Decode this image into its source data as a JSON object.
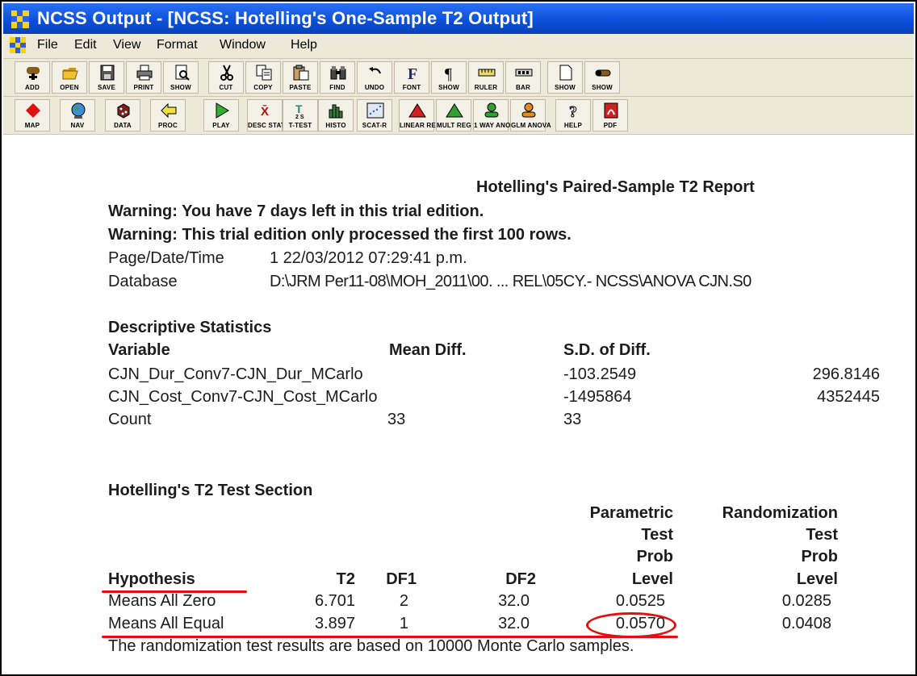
{
  "window": {
    "title": "NCSS Output - [NCSS: Hotelling's One-Sample T2 Output]"
  },
  "menu": [
    "File",
    "Edit",
    "View",
    "Format",
    "Window",
    "Help"
  ],
  "toolbar1": [
    {
      "label": "ADD",
      "icon": "add-icon"
    },
    {
      "label": "OPEN",
      "icon": "open-folder-icon"
    },
    {
      "label": "SAVE",
      "icon": "save-disk-icon"
    },
    {
      "label": "PRINT",
      "icon": "printer-icon"
    },
    {
      "label": "SHOW",
      "icon": "show-preview-icon"
    },
    {
      "label": "CUT",
      "icon": "scissors-icon"
    },
    {
      "label": "COPY",
      "icon": "copy-icon"
    },
    {
      "label": "PASTE",
      "icon": "paste-icon"
    },
    {
      "label": "FIND",
      "icon": "binoculars-icon"
    },
    {
      "label": "UNDO",
      "icon": "undo-icon"
    },
    {
      "label": "FONT",
      "icon": "font-icon"
    },
    {
      "label": "SHOW",
      "icon": "pilcrow-icon"
    },
    {
      "label": "RULER",
      "icon": "ruler-icon"
    },
    {
      "label": "BAR",
      "icon": "bar-icon"
    },
    {
      "label": "SHOW",
      "icon": "page-icon"
    },
    {
      "label": "SHOW",
      "icon": "pill-icon"
    }
  ],
  "toolbar2": [
    {
      "label": "MAP",
      "icon": "map-diamond-icon"
    },
    {
      "label": "NAV",
      "icon": "globe-icon"
    },
    {
      "label": "DATA",
      "icon": "data-icon"
    },
    {
      "label": "PROC",
      "icon": "back-arrow-icon"
    },
    {
      "label": "PLAY",
      "icon": "play-icon"
    },
    {
      "label": "DESC STATS",
      "glyph": "X̄",
      "icon": "desc-stats-icon"
    },
    {
      "label": "T-TEST",
      "glyph": "2 S",
      "icon": "t-test-icon"
    },
    {
      "label": "HISTO",
      "icon": "histogram-icon"
    },
    {
      "label": "SCAT-R",
      "icon": "scatter-icon"
    },
    {
      "label": "LINEAR REG",
      "icon": "linear-reg-icon"
    },
    {
      "label": "MULT REG",
      "icon": "mult-reg-icon"
    },
    {
      "label": "1 WAY ANOVA",
      "icon": "one-way-anova-icon"
    },
    {
      "label": "GLM ANOVA",
      "icon": "glm-anova-icon"
    },
    {
      "label": "HELP",
      "icon": "help-icon"
    },
    {
      "label": "PDF",
      "icon": "pdf-icon"
    }
  ],
  "report": {
    "heading": "Hotelling's Paired-Sample T2 Report",
    "warning1": "Warning: You have 7 days left in this trial edition.",
    "warning2": "Warning: This trial edition only processed the first 100 rows.",
    "page_label": "Page/Date/Time",
    "page_value": "1   22/03/2012 07:29:41 p.m.",
    "db_label": "Database",
    "db_value": "D:\\JRM Per11-08\\MOH_2011\\00. ... REL\\05CY.- NCSS\\ANOVA CJN.S0"
  },
  "descriptive": {
    "title": "Descriptive Statistics",
    "headers": {
      "variable": "Variable",
      "mean": "Mean Diff.",
      "sd": "S.D. of Diff."
    },
    "rows": [
      {
        "name": "CJN_Dur_Conv7-CJN_Dur_MCarlo",
        "mean": "",
        "sd": "-103.2549",
        "extra": "296.8146"
      },
      {
        "name": "CJN_Cost_Conv7-CJN_Cost_MCarlo",
        "mean": "",
        "sd": "-1495864",
        "extra": "4352445"
      },
      {
        "name": "Count",
        "mean": "33",
        "sd": "33",
        "extra": ""
      }
    ]
  },
  "t2test": {
    "title": "Hotelling's T2 Test Section",
    "param_header": [
      "Parametric",
      "Test",
      "Prob",
      "Level"
    ],
    "rand_header": [
      "Randomization",
      "Test",
      "Prob",
      "Level"
    ],
    "headers": {
      "hypothesis": "Hypothesis",
      "t2": "T2",
      "df1": "DF1",
      "df2": "DF2"
    },
    "rows": [
      {
        "hypothesis": "Means All Zero",
        "t2": "6.701",
        "df1": "2",
        "df2": "32.0",
        "param": "0.0525",
        "rand": "0.0285"
      },
      {
        "hypothesis": "Means All Equal",
        "t2": "3.897",
        "df1": "1",
        "df2": "32.0",
        "param": "0.0570",
        "rand": "0.0408"
      }
    ],
    "footnote": "The randomization test results are based on 10000 Monte Carlo samples."
  },
  "colors": {
    "titlebar": "#0b4fd8",
    "chrome": "#ece9d8",
    "annotation": "#e01010"
  }
}
